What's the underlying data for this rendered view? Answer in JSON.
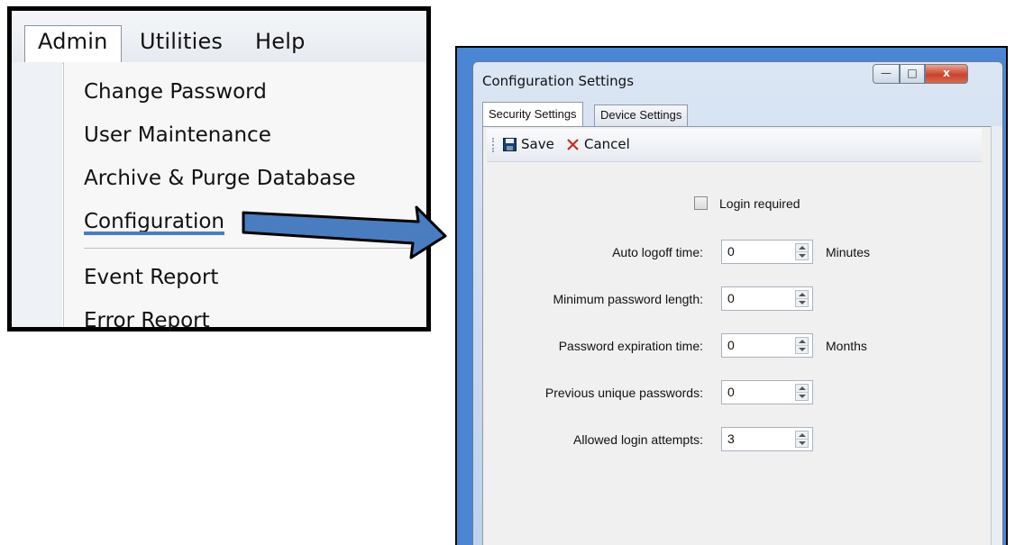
{
  "admin_menu": {
    "menubar": [
      "Admin",
      "Utilities",
      "Help"
    ],
    "items": [
      "Change Password",
      "User Maintenance",
      "Archive & Purge Database",
      "Configuration",
      "Event Report",
      "Error Report"
    ],
    "highlighted_item": "Configuration"
  },
  "config_window": {
    "title": "Configuration Settings",
    "window_buttons": {
      "minimize": "—",
      "maximize": "□",
      "close": "x"
    },
    "tabs": [
      "Security Settings",
      "Device Settings"
    ],
    "active_tab": "Security Settings",
    "toolbar": {
      "save": "Save",
      "cancel": "Cancel"
    },
    "login_required": {
      "label": "Login required",
      "checked": false
    },
    "fields": [
      {
        "label": "Auto logoff time:",
        "value": "0",
        "unit": "Minutes"
      },
      {
        "label": "Minimum password length:",
        "value": "0",
        "unit": ""
      },
      {
        "label": "Password expiration time:",
        "value": "0",
        "unit": "Months"
      },
      {
        "label": "Previous unique passwords:",
        "value": "0",
        "unit": ""
      },
      {
        "label": "Allowed login attempts:",
        "value": "3",
        "unit": ""
      }
    ]
  },
  "colors": {
    "window_frame": "#4a86d4",
    "underline": "#4a7dbf",
    "arrow": "#4a7dbf",
    "close_button": "#c7432b"
  }
}
